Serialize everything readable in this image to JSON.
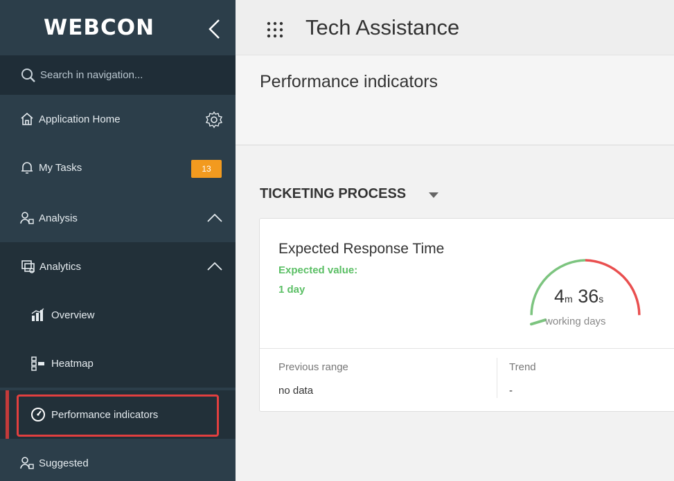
{
  "sidebar": {
    "logo": "WEBCON",
    "search_placeholder": "Search in navigation...",
    "items": [
      {
        "label": "Application Home"
      },
      {
        "label": "My Tasks",
        "badge": "13"
      },
      {
        "label": "Analysis"
      },
      {
        "label": "Analytics"
      },
      {
        "label": "Overview"
      },
      {
        "label": "Heatmap"
      },
      {
        "label": "Performance indicators"
      },
      {
        "label": "Suggested"
      }
    ]
  },
  "topbar": {
    "app_title": "Tech Assistance"
  },
  "page": {
    "title": "Performance indicators"
  },
  "section": {
    "title": "TICKETING PROCESS"
  },
  "kpi": {
    "name": "Expected Response Time",
    "expected_label": "Expected value:",
    "expected_value": "1 day",
    "value_minutes": "4",
    "minutes_unit": "m",
    "value_seconds": "36",
    "seconds_unit": "s",
    "unit_label": "working days",
    "previous_range_label": "Previous range",
    "previous_range_value": "no data",
    "trend_label": "Trend",
    "trend_value": "-",
    "gauge_fraction": 0.05
  },
  "colors": {
    "sidebar_bg": "#2c3e4a",
    "accent_green": "#5bbf65",
    "accent_red": "#e94f4f",
    "badge_orange": "#f29a1f",
    "highlight_red": "#e23f3f"
  }
}
